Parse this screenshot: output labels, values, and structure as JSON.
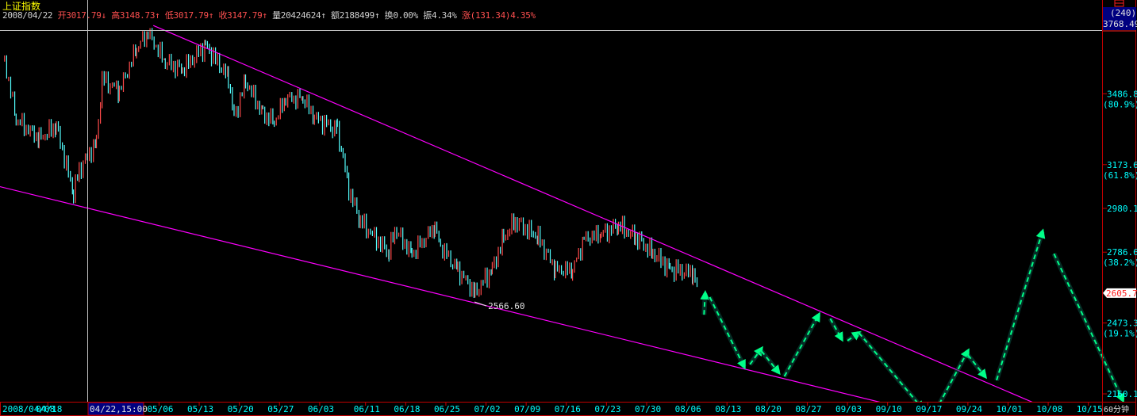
{
  "header": {
    "title": "上证指数",
    "date": "2008/04/22",
    "fields": [
      {
        "label": "开",
        "value": "3017.79",
        "arrow": "↓",
        "color": "red"
      },
      {
        "label": "高",
        "value": "3148.73",
        "arrow": "↑",
        "color": "red"
      },
      {
        "label": "低",
        "value": "3017.79",
        "arrow": "↑",
        "color": "red"
      },
      {
        "label": "收",
        "value": "3147.79",
        "arrow": "↑",
        "color": "red"
      },
      {
        "label": "量",
        "value": "20424624",
        "arrow": "↑",
        "color": "wht"
      },
      {
        "label": "额",
        "value": "2188499",
        "arrow": "↑",
        "color": "wht"
      },
      {
        "label": "换",
        "value": "0.00%",
        "arrow": "",
        "color": "wht"
      },
      {
        "label": "振",
        "value": "4.34%",
        "arrow": "",
        "color": "wht"
      },
      {
        "label": "涨",
        "value": "(131.34)4.35%",
        "arrow": "",
        "color": "red"
      }
    ]
  },
  "period_label": "60分钟",
  "crosshair": {
    "time_label": "04/22,15:00",
    "bar_count": "(240)",
    "price_label": "3768.49"
  },
  "colors": {
    "up": "#ff4a4a",
    "down": "#54ffff",
    "trendline": "#ff00ff",
    "projection": "#00ff88",
    "axis": "#c00000",
    "axis_text": "#00ffff"
  },
  "chart_data": {
    "type": "candlestick",
    "interval": "60分钟",
    "year": 2008,
    "x_ticks": [
      "2008/04/08",
      "04/18",
      "05/06",
      "05/13",
      "05/20",
      "05/27",
      "06/03",
      "06/11",
      "06/18",
      "06/25",
      "07/02",
      "07/09",
      "07/16",
      "07/23",
      "07/30",
      "08/06",
      "08/13",
      "08/20",
      "08/27",
      "09/03",
      "09/10",
      "09/17",
      "09/24",
      "10/01",
      "10/08",
      "10/15"
    ],
    "y_ticks": [
      {
        "value": "3486.8",
        "pct": "(80.9%)"
      },
      {
        "value": "3173.6",
        "pct": "(61.8%)"
      },
      {
        "value": "2980.1",
        "pct": ""
      },
      {
        "value": "2786.6",
        "pct": "(38.2%)"
      },
      {
        "value": "2473.3",
        "pct": "(19.1%)"
      },
      {
        "value": "2160.1",
        "pct": ""
      }
    ],
    "ylim": [
      2160.1,
      3768.49
    ],
    "current_price": "2605.7",
    "low_annotation": {
      "date": "06/30",
      "price": 2566.6,
      "label": "2566.60"
    },
    "close_path": [
      [
        "04/09",
        3639
      ],
      [
        "04/11",
        3376
      ],
      [
        "04/15",
        3288
      ],
      [
        "04/18",
        3341
      ],
      [
        "04/21",
        3043
      ],
      [
        "04/22",
        3147
      ],
      [
        "04/25",
        3271
      ],
      [
        "04/26",
        3551
      ],
      [
        "04/29",
        3500
      ],
      [
        "05/02",
        3691
      ],
      [
        "05/04",
        3761
      ],
      [
        "05/07",
        3628
      ],
      [
        "05/10",
        3593
      ],
      [
        "05/14",
        3698
      ],
      [
        "05/18",
        3558
      ],
      [
        "05/19",
        3376
      ],
      [
        "05/21",
        3541
      ],
      [
        "05/24",
        3400
      ],
      [
        "05/26",
        3365
      ],
      [
        "05/28",
        3470
      ],
      [
        "05/31",
        3470
      ],
      [
        "06/02",
        3383
      ],
      [
        "06/06",
        3323
      ],
      [
        "06/07",
        3200
      ],
      [
        "06/08",
        3060
      ],
      [
        "06/10",
        2920
      ],
      [
        "06/15",
        2780
      ],
      [
        "06/16",
        2887
      ],
      [
        "06/19",
        2780
      ],
      [
        "06/23",
        2902
      ],
      [
        "06/24",
        2815
      ],
      [
        "06/27",
        2710
      ],
      [
        "06/30",
        2605
      ],
      [
        "07/03",
        2710
      ],
      [
        "07/05",
        2850
      ],
      [
        "07/07",
        2920
      ],
      [
        "07/11",
        2850
      ],
      [
        "07/14",
        2710
      ],
      [
        "07/17",
        2710
      ],
      [
        "07/19",
        2850
      ],
      [
        "07/22",
        2868
      ],
      [
        "07/25",
        2903
      ],
      [
        "07/28",
        2850
      ],
      [
        "07/31",
        2780
      ],
      [
        "08/03",
        2710
      ],
      [
        "08/07",
        2693
      ],
      [
        "08/08",
        2605.7
      ]
    ],
    "trendlines": [
      [
        [
          "05/05",
          3789
        ],
        [
          "10/06",
          2115
        ]
      ],
      [
        [
          "04/08",
          3078
        ],
        [
          "09/10",
          2115
        ]
      ]
    ],
    "projection": [
      [
        [
          "08/09",
          2510
        ],
        [
          "08/09",
          2605
        ]
      ],
      [
        [
          "08/10",
          2588
        ],
        [
          "08/16",
          2280
        ]
      ],
      [
        [
          "08/17",
          2290
        ],
        [
          "08/19",
          2360
        ]
      ],
      [
        [
          "08/19",
          2350
        ],
        [
          "08/22",
          2255
        ]
      ],
      [
        [
          "08/23",
          2237
        ],
        [
          "08/29",
          2510
        ]
      ],
      [
        [
          "08/31",
          2493
        ],
        [
          "09/02",
          2402
        ]
      ],
      [
        [
          "09/03",
          2395
        ],
        [
          "09/05",
          2430
        ]
      ],
      [
        [
          "09/05",
          2430
        ],
        [
          "09/16",
          2097
        ]
      ],
      [
        [
          "09/19",
          2115
        ],
        [
          "09/24",
          2350
        ]
      ],
      [
        [
          "09/24",
          2332
        ],
        [
          "09/27",
          2237
        ]
      ],
      [
        [
          "09/29",
          2220
        ],
        [
          "10/07",
          2878
        ]
      ],
      [
        [
          "10/09",
          2780
        ],
        [
          "10/21",
          2132
        ]
      ]
    ]
  }
}
